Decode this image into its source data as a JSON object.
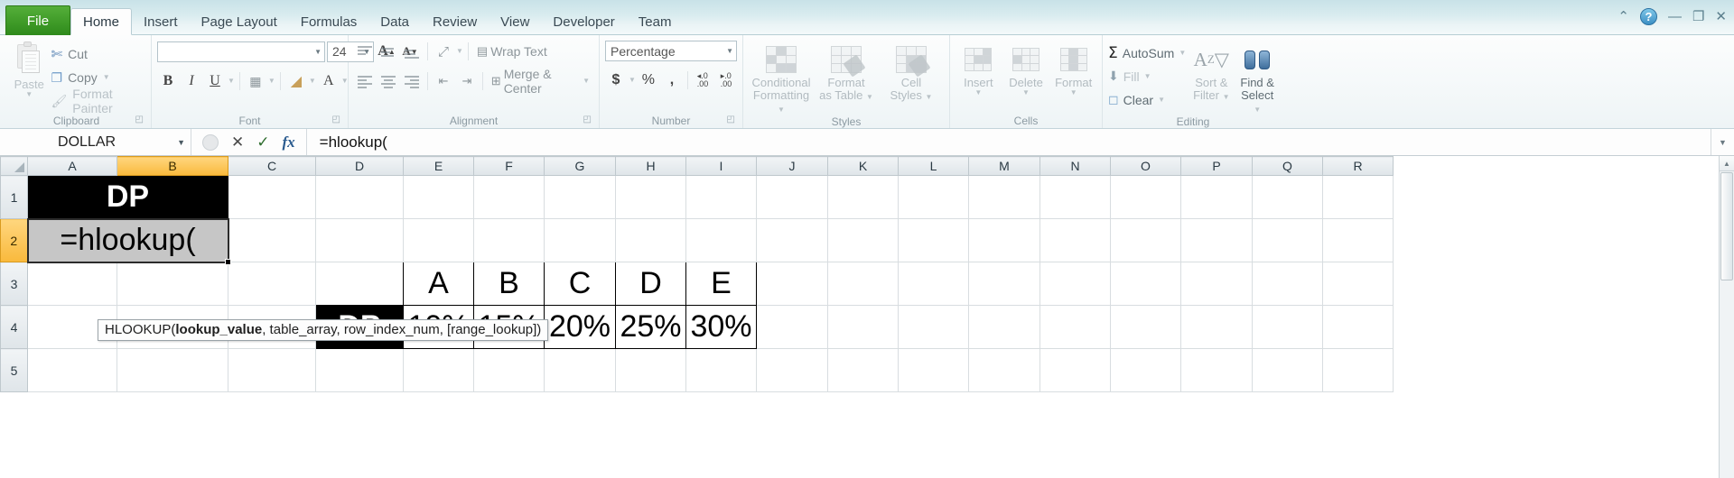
{
  "window": {
    "tabs": [
      "File",
      "Home",
      "Insert",
      "Page Layout",
      "Formulas",
      "Data",
      "Review",
      "View",
      "Developer",
      "Team"
    ],
    "active_tab": "Home",
    "controls": {
      "help": "?",
      "minimize": "—",
      "restore": "❐",
      "close": "✕",
      "ribbon_collapse": "⌃"
    }
  },
  "ribbon": {
    "groups": [
      {
        "name": "Clipboard",
        "label": "Clipboard"
      },
      {
        "name": "Font",
        "label": "Font"
      },
      {
        "name": "Alignment",
        "label": "Alignment"
      },
      {
        "name": "Number",
        "label": "Number"
      },
      {
        "name": "Styles",
        "label": "Styles"
      },
      {
        "name": "Cells",
        "label": "Cells"
      },
      {
        "name": "Editing",
        "label": "Editing"
      }
    ],
    "clipboard": {
      "paste": "Paste",
      "cut": "Cut",
      "copy": "Copy",
      "format_painter": "Format Painter"
    },
    "font": {
      "font_name_value": "",
      "font_size_value": "24",
      "bold": "B",
      "italic": "I",
      "underline": "U",
      "grow_font": "A",
      "shrink_font": "A",
      "borders": "borders",
      "fill_color": "A",
      "font_color": "A"
    },
    "alignment": {
      "wrap_text": "Wrap Text",
      "merge_center": "Merge & Center",
      "orientation": "orientation",
      "indent_decrease": "decrease-indent",
      "indent_increase": "increase-indent"
    },
    "number": {
      "format_value": "Percentage",
      "accounting": "$",
      "percent": "%",
      "comma": ",",
      "increase_decimal": ".00",
      "decrease_decimal": ".00"
    },
    "styles": {
      "conditional_formatting": "Conditional\nFormatting",
      "conditional_formatting_l1": "Conditional",
      "conditional_formatting_l2": "Formatting",
      "format_as_table_l1": "Format",
      "format_as_table_l2": "as Table",
      "cell_styles_l1": "Cell",
      "cell_styles_l2": "Styles"
    },
    "cells": {
      "insert": "Insert",
      "delete": "Delete",
      "format": "Format"
    },
    "editing": {
      "autosum": "AutoSum",
      "fill": "Fill",
      "clear": "Clear",
      "sort_filter_l1": "Sort &",
      "sort_filter_l2": "Filter",
      "find_select_l1": "Find &",
      "find_select_l2": "Select"
    }
  },
  "formula_bar": {
    "name_box_value": "DOLLAR",
    "cancel": "✕",
    "enter": "✓",
    "insert_function": "fx",
    "formula_value": "=hlookup("
  },
  "sheet": {
    "column_headers": [
      "A",
      "B",
      "C",
      "D",
      "E",
      "F",
      "G",
      "H",
      "I",
      "J",
      "K",
      "L",
      "M",
      "N",
      "O",
      "P",
      "Q",
      "R"
    ],
    "selected_column": "B",
    "row_headers": [
      "1",
      "2",
      "3",
      "4",
      "5"
    ],
    "cells": {
      "a1_dp": "DP",
      "b2_formula": "=hlookup(",
      "d4_dp": "DP",
      "headers_row3": [
        "A",
        "B",
        "C",
        "D",
        "E"
      ],
      "values_row4": [
        "10%",
        "15%",
        "20%",
        "25%",
        "30%"
      ]
    }
  },
  "tooltip": {
    "prefix": "HLOOKUP(",
    "bold_arg": "lookup_value",
    "rest": ", table_array, row_index_num, [range_lookup])"
  }
}
